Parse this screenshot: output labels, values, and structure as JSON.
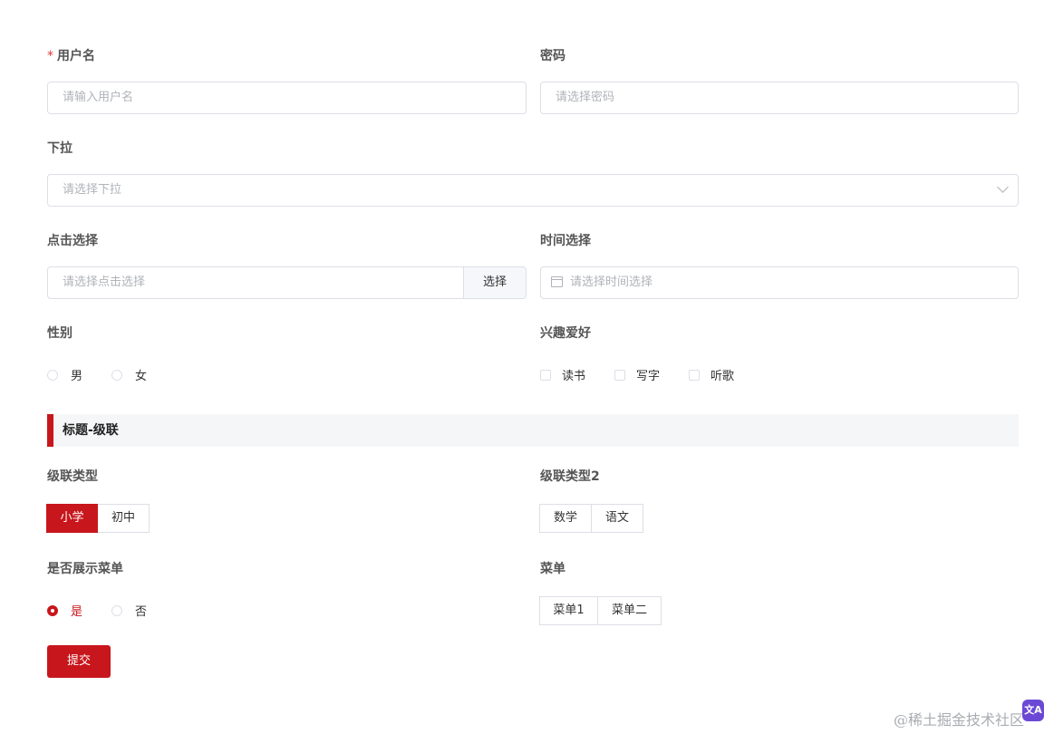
{
  "form": {
    "username": {
      "label": "用户名",
      "required_mark": "*",
      "placeholder": "请输入用户名"
    },
    "password": {
      "label": "密码",
      "placeholder": "请选择密码"
    },
    "dropdown": {
      "label": "下拉",
      "placeholder": "请选择下拉",
      "icon": "chevron-down-icon"
    },
    "click_select": {
      "label": "点击选择",
      "placeholder": "请选择点击选择",
      "button": "选择"
    },
    "time_select": {
      "label": "时间选择",
      "placeholder": "请选择时间选择",
      "icon": "calendar-icon"
    },
    "gender": {
      "label": "性别",
      "options": [
        "男",
        "女"
      ],
      "selected": null
    },
    "hobbies": {
      "label": "兴趣爱好",
      "options": [
        "读书",
        "写字",
        "听歌"
      ],
      "checked": []
    },
    "section_title": "标题-级联",
    "cascade_type": {
      "label": "级联类型",
      "options": [
        "小学",
        "初中"
      ],
      "selected": "小学"
    },
    "cascade_type2": {
      "label": "级联类型2",
      "options": [
        "数学",
        "语文"
      ],
      "selected": null
    },
    "show_menu": {
      "label": "是否展示菜单",
      "options": [
        "是",
        "否"
      ],
      "selected": "是"
    },
    "menu": {
      "label": "菜单",
      "options": [
        "菜单1",
        "菜单二"
      ],
      "selected": null
    },
    "submit_label": "提交"
  },
  "watermark": "@稀土掘金技术社区",
  "colors": {
    "accent": "#c8161d",
    "border": "#dcdfe6",
    "placeholder": "#b0b3b8"
  }
}
